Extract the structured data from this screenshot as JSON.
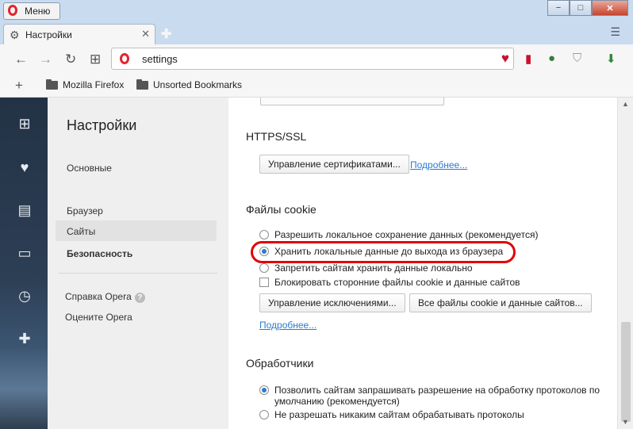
{
  "titlebar": {
    "menu_label": "Меню",
    "controls": {
      "minimize": "−",
      "maximize": "□",
      "close": "✕"
    }
  },
  "tabs": [
    {
      "label": "Настройки",
      "close": "✕"
    }
  ],
  "tabbar": {
    "new_tab": "✚",
    "menu": "☰"
  },
  "toolbar": {
    "back": "←",
    "forward": "→",
    "reload": "↻",
    "speed_dial": "⊞",
    "address_value": "settings",
    "heart": "♥"
  },
  "bookmarks": {
    "add": "+",
    "items": [
      {
        "label": "Mozilla Firefox"
      },
      {
        "label": "Unsorted Bookmarks"
      }
    ]
  },
  "sidebar": {
    "title": "Настройки",
    "items": [
      {
        "label": "Основные"
      },
      {
        "label": "Браузер"
      },
      {
        "label": "Сайты"
      },
      {
        "label": "Безопасность"
      }
    ],
    "footer": [
      {
        "label": "Справка Opera"
      },
      {
        "label": "Оцените Opera"
      }
    ],
    "help_mark": "?"
  },
  "content": {
    "https": {
      "title": "HTTPS/SSL",
      "button": "Управление сертификатами...",
      "link": "Подробнее..."
    },
    "cookies": {
      "title": "Файлы cookie",
      "options": [
        {
          "label": "Разрешить локальное сохранение данных (рекомендуется)",
          "selected": false
        },
        {
          "label": "Хранить локальные данные до выхода из браузера",
          "selected": true
        },
        {
          "label": "Запретить сайтам хранить данные локально",
          "selected": false
        }
      ],
      "checkbox": {
        "label": "Блокировать сторонние файлы cookie и данные сайтов",
        "checked": false
      },
      "button_exceptions": "Управление исключениями...",
      "button_all": "Все файлы cookie и данные сайтов...",
      "link": "Подробнее..."
    },
    "handlers": {
      "title": "Обработчики",
      "options": [
        {
          "line1": "Позволить сайтам запрашивать разрешение на обработку протоколов по",
          "line2": "умолчанию (рекомендуется)",
          "selected": true
        },
        {
          "line1": "Не разрешать никаким сайтам обрабатывать протоколы",
          "line2": "",
          "selected": false
        }
      ]
    }
  },
  "colors": {
    "accent": "#2a7ad2",
    "opera_red": "#e0262d",
    "highlight_ring": "#e30000"
  }
}
